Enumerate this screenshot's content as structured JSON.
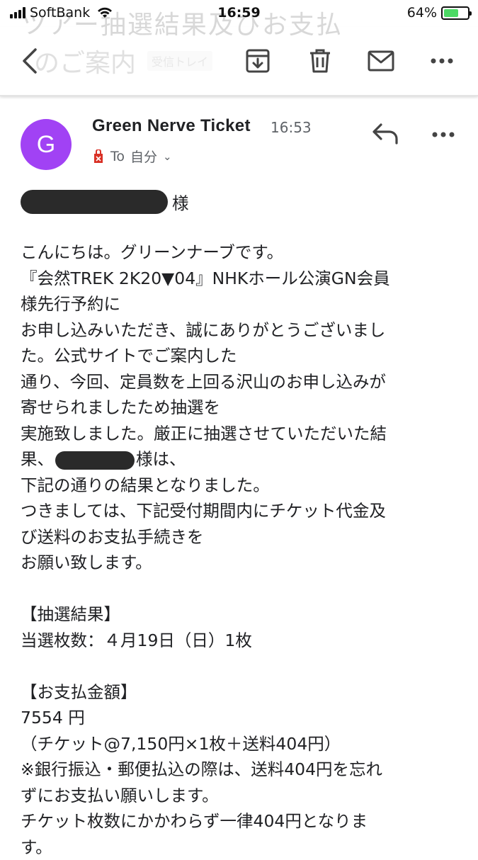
{
  "status_bar": {
    "carrier": "SoftBank",
    "time": "16:59",
    "battery": "64%",
    "battery_level": 64
  },
  "background_subject": {
    "line1": "ツアー抽選結果及びお支払",
    "line2": "のご案内",
    "label": "受信トレイ"
  },
  "toolbar": {
    "back_icon": "arrow-left-icon",
    "archive_icon": "archive-icon",
    "delete_icon": "trash-icon",
    "mark_unread_icon": "mail-icon",
    "more_icon": "more-horizontal-icon"
  },
  "header": {
    "avatar_letter": "G",
    "avatar_color": "#a142f4",
    "sender": "Green Nerve Ticket",
    "time": "16:53",
    "recipient_prefix": "To",
    "recipient": "自分",
    "important_color": "#d93025"
  },
  "body": {
    "greeting_suffix": "様",
    "lines": [
      "こんにちは。グリーンナーブです。",
      "『会然TREK 2K20▼04』NHKホール公演GN会員",
      "様先行予約に",
      "お申し込みいただき、誠にありがとうございまし",
      "た。公式サイトでご案内した",
      "通り、今回、定員数を上回る沢山のお申し込みが",
      "寄せられましたため抽選を",
      "実施致しました。厳正に抽選させていただいた結"
    ],
    "redacted_line_prefix": "果、",
    "redacted_line_suffix": "様は、",
    "lines2": [
      "下記の通りの結果となりました。",
      "つきましては、下記受付期間内にチケット代金及",
      "び送料のお支払手続きを",
      "お願い致します。"
    ],
    "result_heading": "【抽選結果】",
    "result_line": "当選枚数：４月19日（日）1枚",
    "payment_heading": "【お支払金額】",
    "payment_amount": "7554 円",
    "payment_breakdown": "（チケット@7,150円×1枚＋送料404円）",
    "notes": [
      "※銀行振込・郵便払込の際は、送料404円を忘れ",
      "ずにお支払い願いします。",
      "チケット枚数にかかわらず一律404円となりま",
      "す。"
    ]
  }
}
